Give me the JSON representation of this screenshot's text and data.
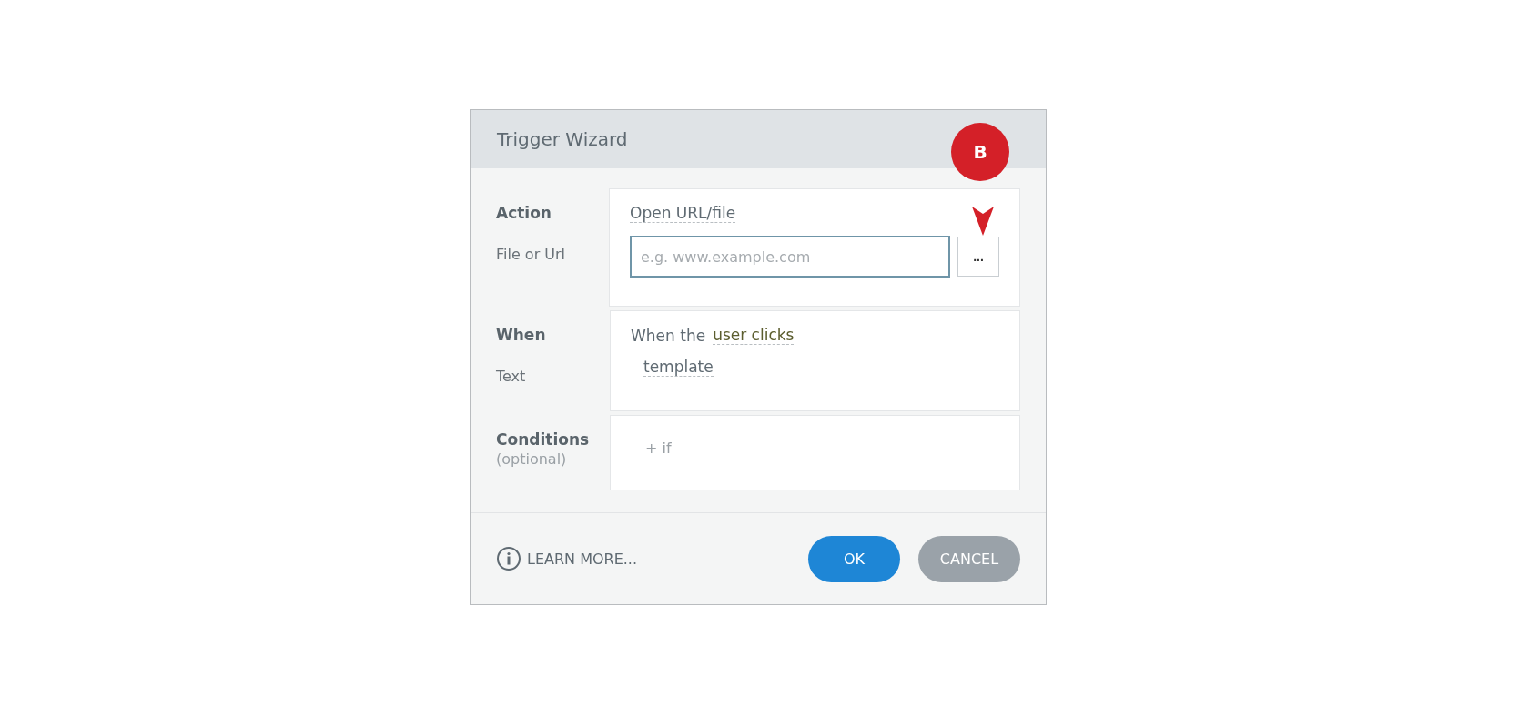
{
  "window": {
    "title": "Trigger Wizard"
  },
  "callout": {
    "label": "B"
  },
  "sections": [
    {
      "kind": "action",
      "label": "Action",
      "sublabel": "File or Url",
      "value": "Open URL/file",
      "field": {
        "placeholder": "e.g. www.example.com"
      },
      "browse": "..."
    },
    {
      "kind": "when",
      "label": "When",
      "sublabel": "Text",
      "prefix": "When the",
      "value": "user clicks",
      "target": "template"
    },
    {
      "kind": "conditions",
      "label": "Conditions",
      "sublabel": "(optional)",
      "add": "+ if"
    }
  ],
  "footer": {
    "learn_more": "LEARN MORE...",
    "buttons": [
      {
        "label": "OK",
        "kind": "primary"
      },
      {
        "label": "CANCEL",
        "kind": "secondary"
      }
    ]
  }
}
